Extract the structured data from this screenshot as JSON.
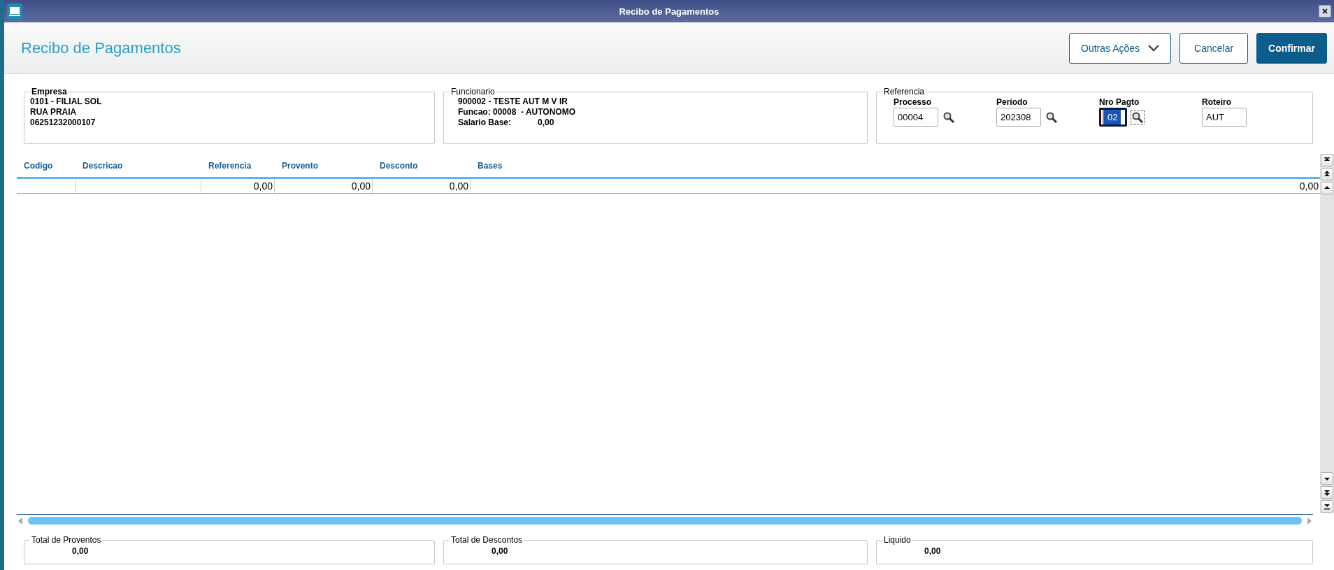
{
  "window": {
    "title": "Recibo de Pagamentos"
  },
  "header": {
    "title": "Recibo de Pagamentos",
    "buttons": [
      {
        "label": "Outras Ações",
        "kind": "menu"
      },
      {
        "label": "Cancelar",
        "kind": "secondary"
      },
      {
        "label": "Confirmar",
        "kind": "primary"
      }
    ]
  },
  "empresa": {
    "legend": "Empresa",
    "lines": [
      "0101 - FILIAL SOL",
      "RUA PRAIA",
      "06251232000107"
    ]
  },
  "funcionario": {
    "legend": "Funcionario",
    "lines": [
      "900002 - TESTE AUT M V IR",
      "Funcao: 00008  - AUTONOMO"
    ],
    "salary_label": "Salario Base:",
    "salary_value": "0,00"
  },
  "referencia": {
    "legend": "Referencia",
    "fields": [
      {
        "label": "Processo",
        "value": "00004",
        "lookup": true,
        "focused": false
      },
      {
        "label": "Período",
        "value": "202308",
        "lookup": true,
        "focused": false
      },
      {
        "label": "Nro Pagto",
        "value": "02",
        "lookup": true,
        "focused": true
      },
      {
        "label": "Roteiro",
        "value": "AUT",
        "lookup": false,
        "focused": false
      }
    ]
  },
  "table": {
    "columns": [
      "Codigo",
      "Descricao",
      "Referencia",
      "Provento",
      "Desconto",
      "Bases"
    ],
    "rows": [
      [
        "",
        "",
        "0,00",
        "0,00",
        "0,00",
        "0,00"
      ]
    ]
  },
  "totals": [
    {
      "legend": "Total de Proventos",
      "value": "0,00"
    },
    {
      "legend": "Total de Descontos",
      "value": "0,00"
    },
    {
      "legend": "Liquido",
      "value": "0,00"
    }
  ]
}
